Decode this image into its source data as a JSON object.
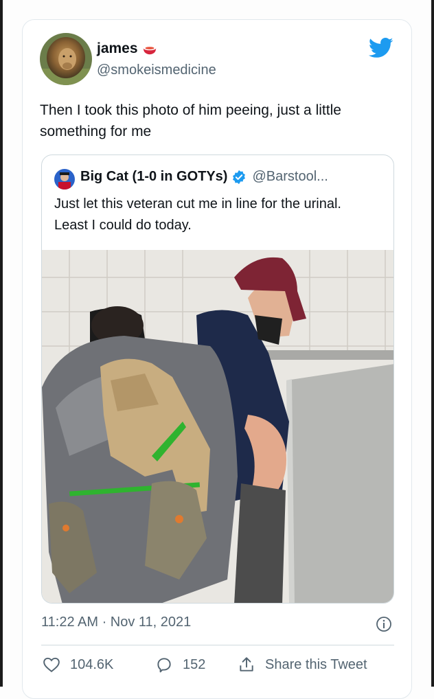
{
  "tweet": {
    "display_name": "james",
    "handle": "@smokeismedicine",
    "text": "Then I took this photo of him peeing, just a little something for me",
    "timestamp": "11:22 AM · Nov 11, 2021"
  },
  "quoted": {
    "display_name": "Big Cat (1-0 in GOTYs)",
    "handle": "@Barstool...",
    "text": "Just let this veteran cut me in line for the urinal. Least I could do today."
  },
  "actions": {
    "likes": "104.6K",
    "replies": "152",
    "share_label": "Share this Tweet"
  },
  "colors": {
    "twitter_blue": "#1d9bf0",
    "text": "#0f1419",
    "secondary_text": "#536471",
    "border": "#cfd9de"
  },
  "icons": [
    "bowl-emoji-icon",
    "twitter-bird-icon",
    "verified-badge-icon",
    "info-icon",
    "heart-icon",
    "reply-icon",
    "share-icon"
  ]
}
